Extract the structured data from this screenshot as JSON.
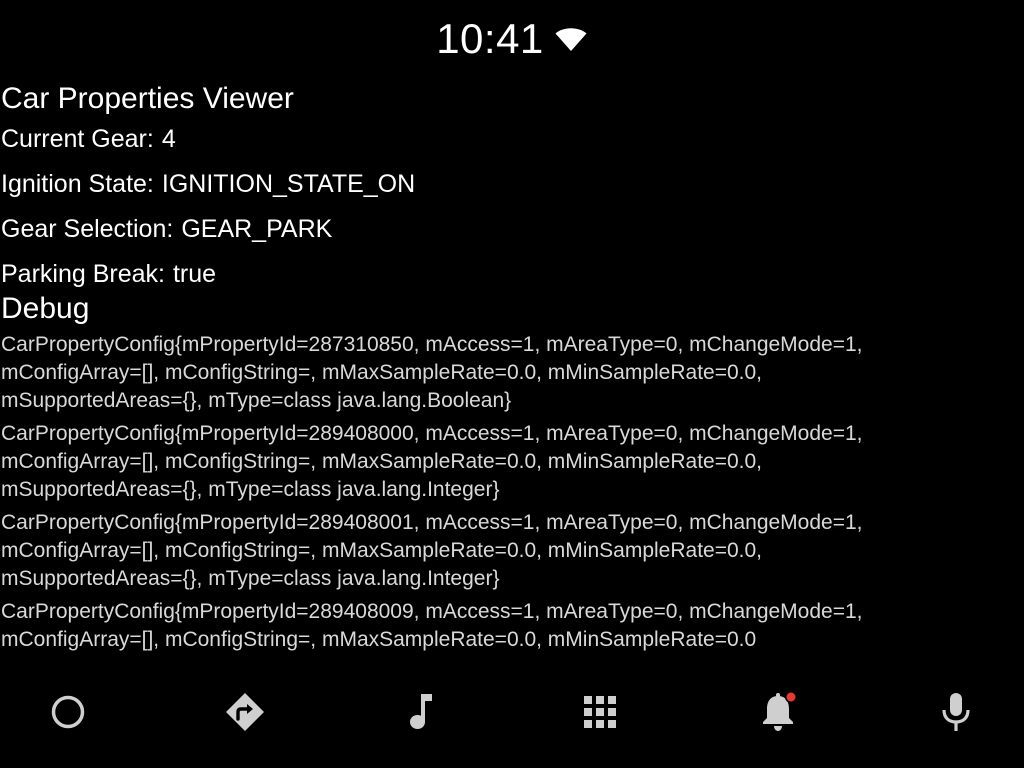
{
  "status_bar": {
    "time": "10:41",
    "wifi_icon": "wifi-icon"
  },
  "app": {
    "title": "Car Properties Viewer"
  },
  "properties": [
    {
      "label": "Current Gear:",
      "value": "4"
    },
    {
      "label": "Ignition State:",
      "value": "IGNITION_STATE_ON"
    },
    {
      "label": "Gear Selection:",
      "value": "GEAR_PARK"
    },
    {
      "label": "Parking Break:",
      "value": "true"
    }
  ],
  "debug": {
    "heading": "Debug",
    "entries": [
      "CarPropertyConfig{mPropertyId=287310850, mAccess=1, mAreaType=0, mChangeMode=1,\nmConfigArray=[], mConfigString=, mMaxSampleRate=0.0, mMinSampleRate=0.0,\nmSupportedAreas={}, mType=class java.lang.Boolean}",
      "CarPropertyConfig{mPropertyId=289408000, mAccess=1, mAreaType=0, mChangeMode=1,\nmConfigArray=[], mConfigString=, mMaxSampleRate=0.0, mMinSampleRate=0.0,\nmSupportedAreas={}, mType=class java.lang.Integer}",
      "CarPropertyConfig{mPropertyId=289408001, mAccess=1, mAreaType=0, mChangeMode=1,\nmConfigArray=[], mConfigString=, mMaxSampleRate=0.0, mMinSampleRate=0.0,\nmSupportedAreas={}, mType=class java.lang.Integer}",
      "CarPropertyConfig{mPropertyId=289408009, mAccess=1, mAreaType=0, mChangeMode=1,\nmConfigArray=[], mConfigString=, mMaxSampleRate=0.0, mMinSampleRate=0.0"
    ]
  },
  "nav_bar": {
    "buttons": [
      {
        "icon": "home-circle-icon"
      },
      {
        "icon": "navigation-icon"
      },
      {
        "icon": "music-note-icon"
      },
      {
        "icon": "app-grid-icon"
      },
      {
        "icon": "notification-bell-icon",
        "has_badge": true
      },
      {
        "icon": "microphone-icon"
      }
    ]
  },
  "colors": {
    "background": "#000000",
    "text_primary": "#ffffff",
    "text_debug": "#d9d9d9",
    "icon": "#cfcfcf",
    "badge": "#e53935"
  }
}
